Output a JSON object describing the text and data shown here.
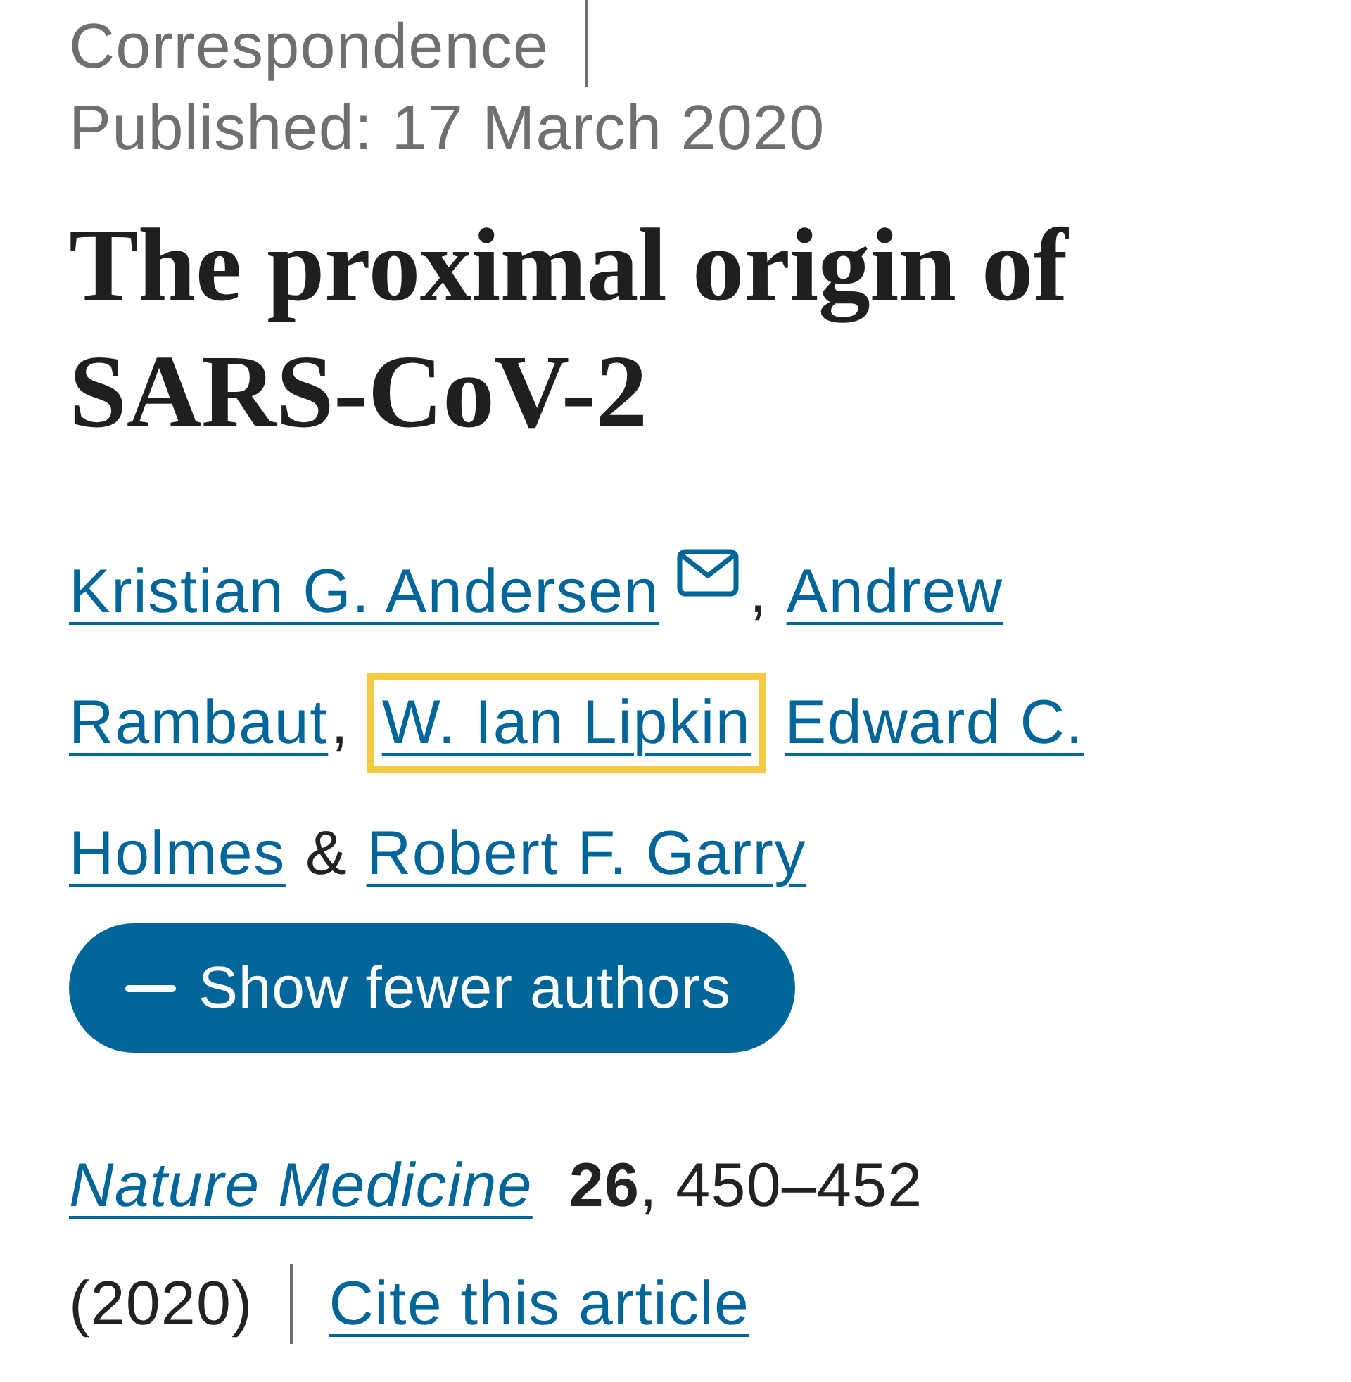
{
  "header": {
    "article_type": "Correspondence",
    "published": "Published: 17 March 2020"
  },
  "title": "The proximal origin of SARS-CoV-2",
  "author_lines": [
    [
      {
        "kind": "link",
        "text": "Kristian G. Andersen",
        "email": true,
        "highlighted": false
      },
      {
        "kind": "comma",
        "text": ","
      },
      {
        "kind": "link",
        "text": "Andrew",
        "email": false,
        "highlighted": false
      }
    ],
    [
      {
        "kind": "link",
        "text": "Rambaut",
        "email": false,
        "highlighted": false
      },
      {
        "kind": "comma",
        "text": ","
      },
      {
        "kind": "link",
        "text": "W. Ian Lipkin",
        "email": false,
        "highlighted": true
      },
      {
        "kind": "link",
        "text": "Edward C.",
        "email": false,
        "highlighted": false
      }
    ],
    [
      {
        "kind": "link",
        "text": "Holmes",
        "email": false,
        "highlighted": false
      },
      {
        "kind": "conjunction",
        "text": "&"
      },
      {
        "kind": "link",
        "text": "Robert F. Garry",
        "email": false,
        "highlighted": false
      }
    ]
  ],
  "authors_toggle": {
    "label": "Show fewer authors",
    "expanded": true
  },
  "citation": {
    "journal": "Nature Medicine",
    "volume_pages": "**26**, 450–452",
    "year": "(2020)",
    "cite_link": "Cite this article"
  }
}
